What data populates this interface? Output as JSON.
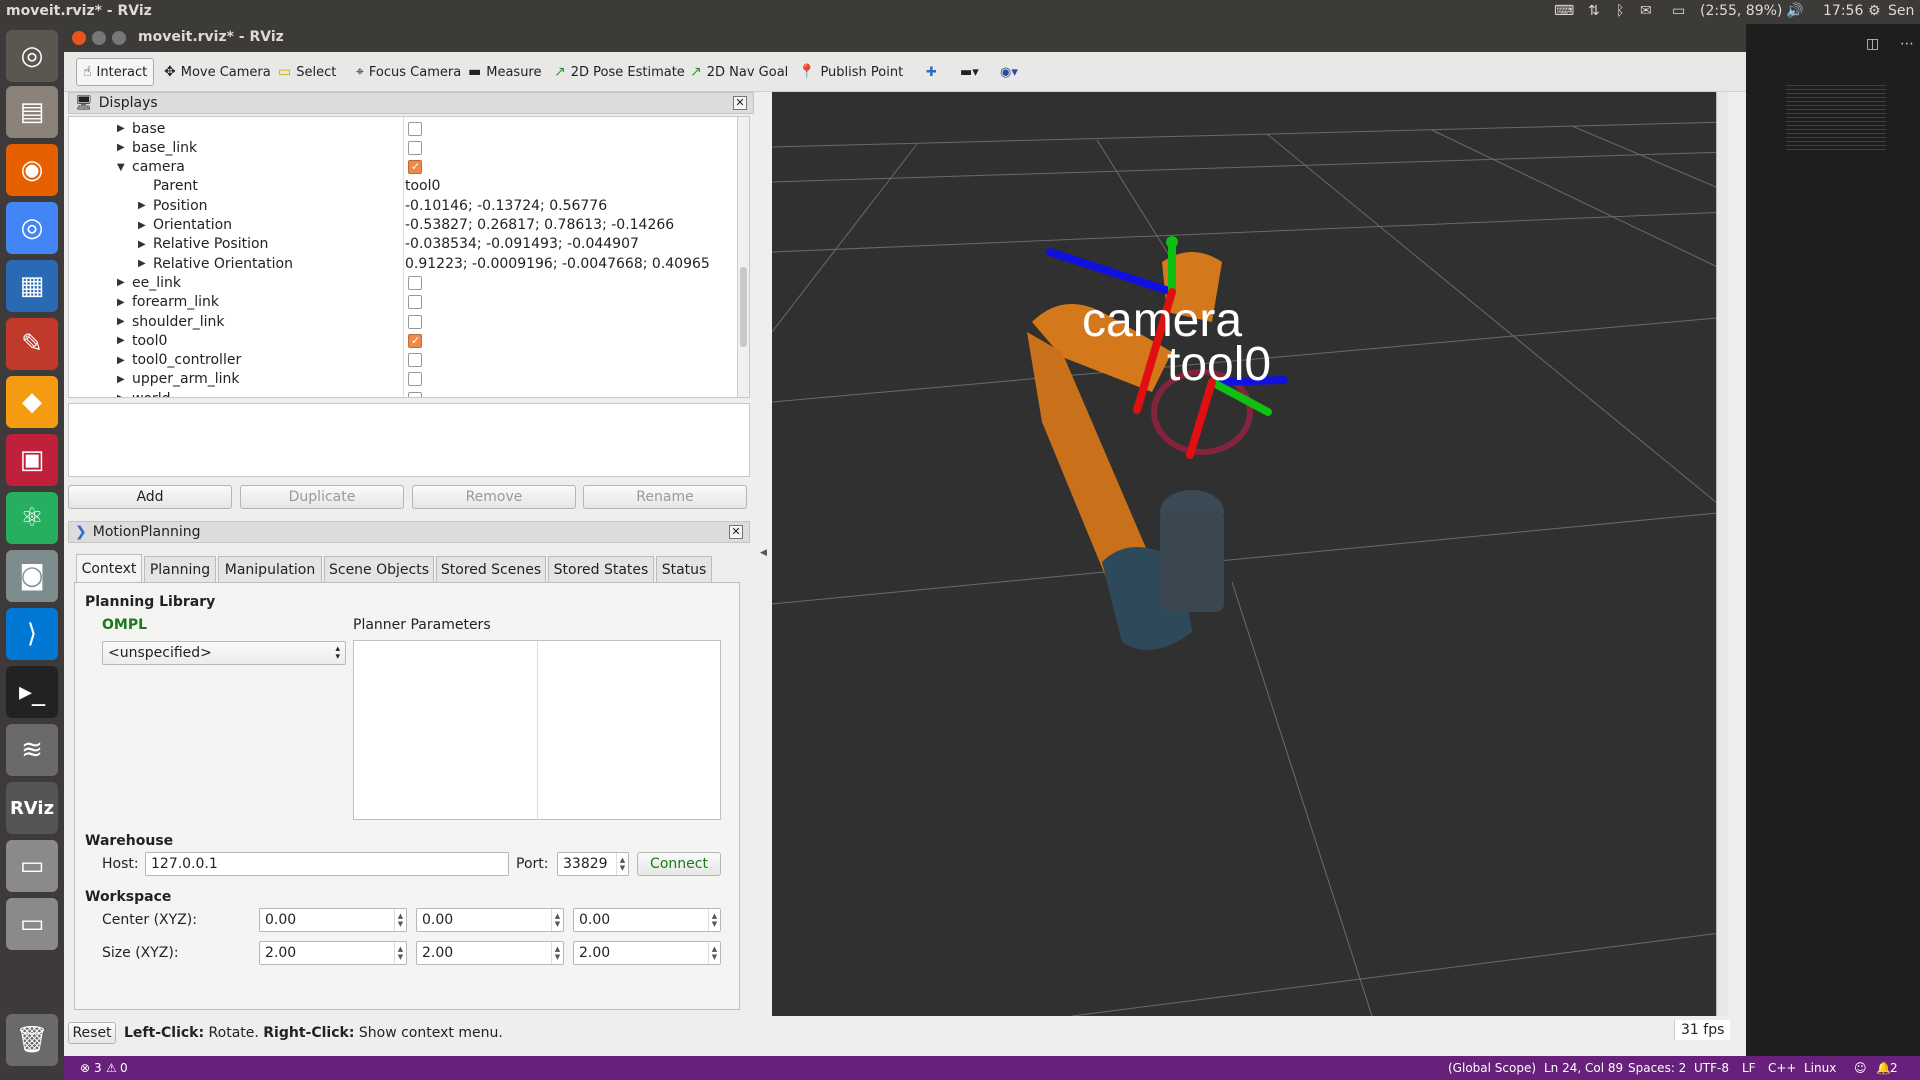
{
  "system": {
    "title": "moveit.rviz* - RViz",
    "battery": "(2:55, 89%)",
    "time": "17:56",
    "user": "Sen"
  },
  "window": {
    "title": "moveit.rviz* - RViz"
  },
  "toolbar": {
    "interact": "Interact",
    "move_camera": "Move Camera",
    "select": "Select",
    "focus_camera": "Focus Camera",
    "measure": "Measure",
    "pose_estimate": "2D Pose Estimate",
    "nav_goal": "2D Nav Goal",
    "publish_point": "Publish Point"
  },
  "displays": {
    "title": "Displays",
    "rows": [
      {
        "name": "base"
      },
      {
        "name": "base_link"
      },
      {
        "name": "camera"
      },
      {
        "name": "Parent",
        "value": "tool0"
      },
      {
        "name": "Position",
        "value": "-0.10146; -0.13724; 0.56776"
      },
      {
        "name": "Orientation",
        "value": "-0.53827; 0.26817; 0.78613; -0.14266"
      },
      {
        "name": "Relative Position",
        "value": "-0.038534; -0.091493; -0.044907"
      },
      {
        "name": "Relative Orientation",
        "value": "0.91223; -0.0009196; -0.0047668; 0.40965"
      },
      {
        "name": "ee_link"
      },
      {
        "name": "forearm_link"
      },
      {
        "name": "shoulder_link"
      },
      {
        "name": "tool0"
      },
      {
        "name": "tool0_controller"
      },
      {
        "name": "upper_arm_link"
      },
      {
        "name": "world"
      }
    ],
    "buttons": {
      "add": "Add",
      "duplicate": "Duplicate",
      "remove": "Remove",
      "rename": "Rename"
    }
  },
  "motion": {
    "title": "MotionPlanning",
    "tabs": [
      "Context",
      "Planning",
      "Manipulation",
      "Scene Objects",
      "Stored Scenes",
      "Stored States",
      "Status"
    ],
    "planning_library": "Planning Library",
    "ompl": "OMPL",
    "planner_select": "<unspecified>",
    "planner_params": "Planner Parameters",
    "warehouse": "Warehouse",
    "host_label": "Host:",
    "host": "127.0.0.1",
    "port_label": "Port:",
    "port": "33829",
    "connect": "Connect",
    "workspace": "Workspace",
    "center_label": "Center (XYZ):",
    "size_label": "Size (XYZ):",
    "center": [
      "0.00",
      "0.00",
      "0.00"
    ],
    "size": [
      "2.00",
      "2.00",
      "2.00"
    ]
  },
  "viewport": {
    "label_camera": "camera",
    "label_tool0": "tool0"
  },
  "status": {
    "reset": "Reset",
    "left_click": "Left-Click:",
    "rotate": " Rotate. ",
    "right_click": "Right-Click:",
    "context_menu": " Show context menu.",
    "fps": "31 fps"
  },
  "vscode": {
    "errors": "3",
    "warnings": "0",
    "scope": "(Global Scope)",
    "position": "Ln 24, Col 89",
    "spaces": "Spaces: 2",
    "encoding": "UTF-8",
    "eol": "LF",
    "language": "C++",
    "os": "Linux",
    "notifications": "2"
  },
  "colors": {
    "accent_orange": "#f08a4b",
    "launcher": "#3e3a3a",
    "vscode_status": "#68217a",
    "green_text": "#1a7a1a"
  }
}
